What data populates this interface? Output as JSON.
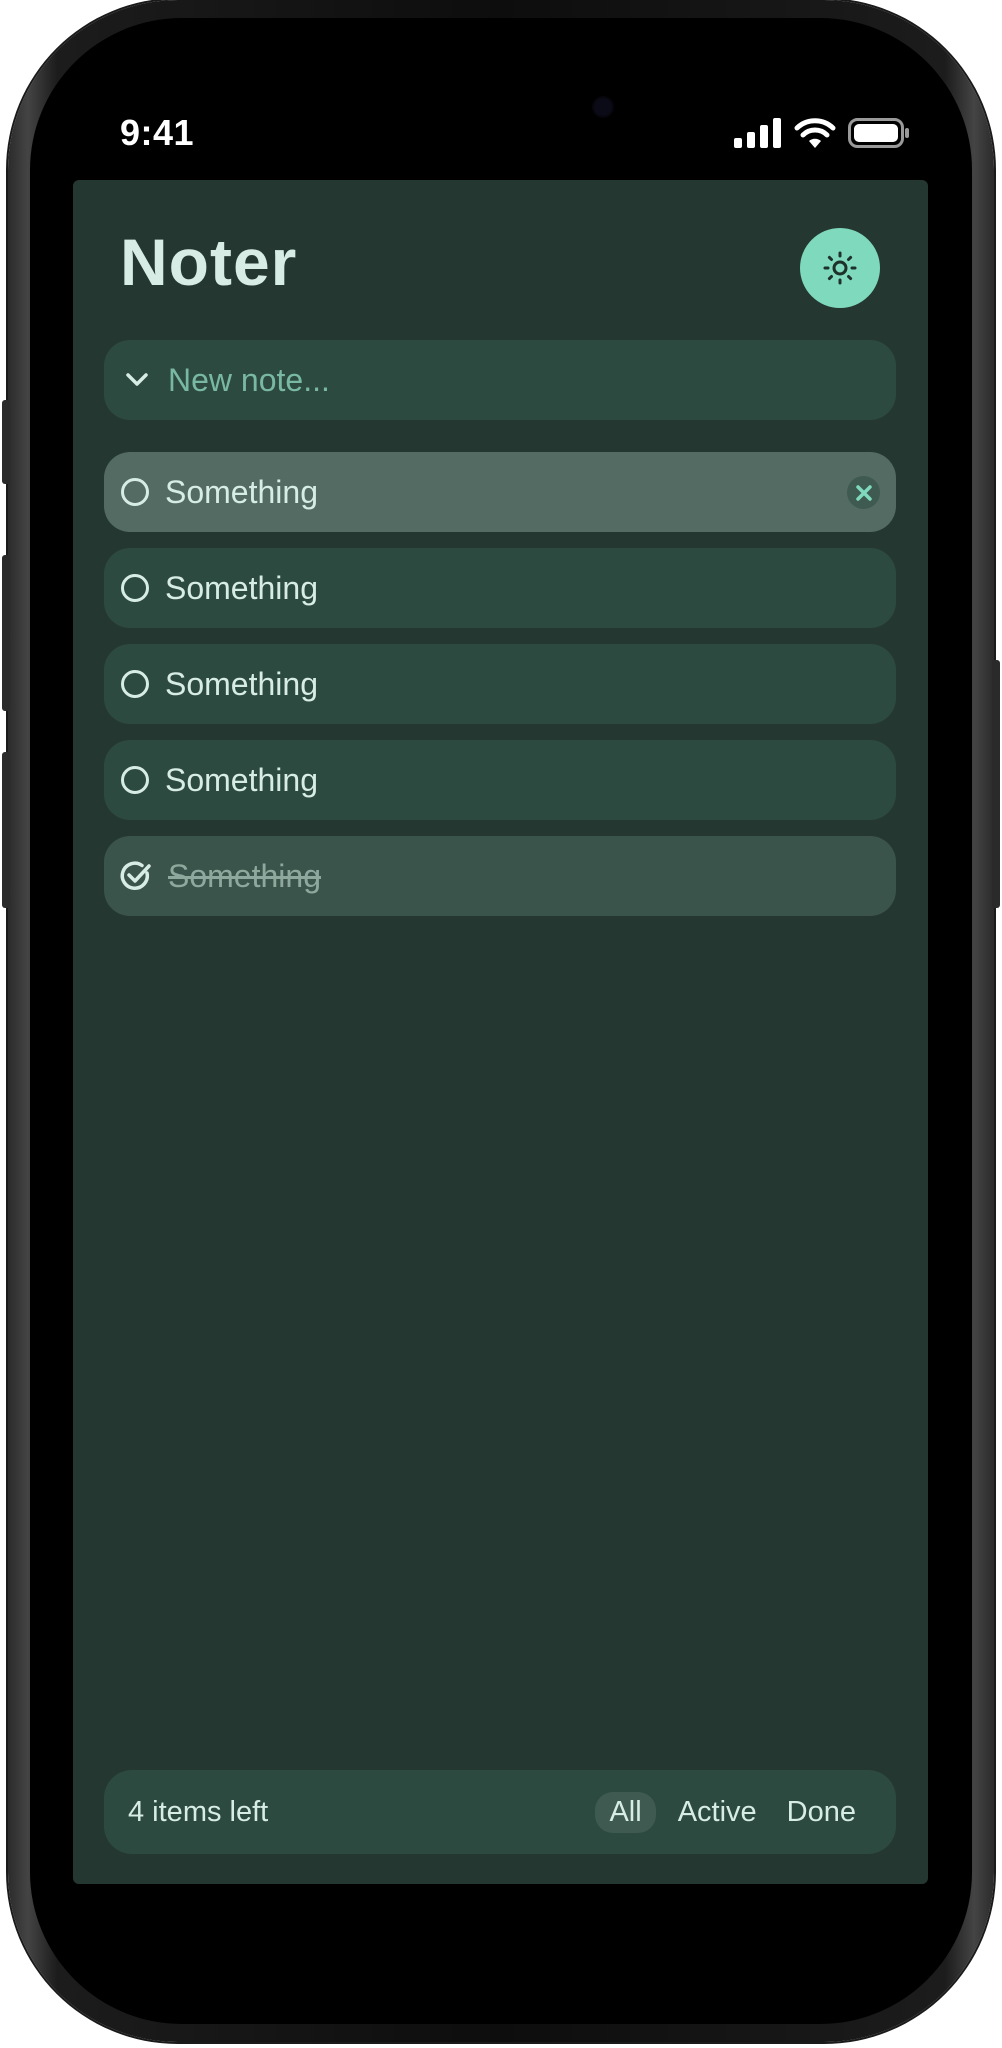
{
  "status_bar": {
    "time": "9:41",
    "icons": [
      "signal-icon",
      "wifi-icon",
      "battery-icon"
    ]
  },
  "app": {
    "title": "Noter",
    "theme_toggle_icon": "sun-icon"
  },
  "new_note": {
    "placeholder": "New note...",
    "value": ""
  },
  "notes": [
    {
      "text": "Something",
      "done": false,
      "hovered": true
    },
    {
      "text": "Something",
      "done": false,
      "hovered": false
    },
    {
      "text": "Something",
      "done": false,
      "hovered": false
    },
    {
      "text": "Something",
      "done": false,
      "hovered": false
    },
    {
      "text": "Something",
      "done": true,
      "hovered": false
    }
  ],
  "footer": {
    "items_left": "4 items left",
    "filters": [
      "All",
      "Active",
      "Done"
    ],
    "selected_filter": "All"
  },
  "colors": {
    "background": "#243831",
    "surface": "#2d4a40",
    "accent": "#7fd9bd",
    "text": "#d6ece4",
    "placeholder": "#79b8a2"
  }
}
